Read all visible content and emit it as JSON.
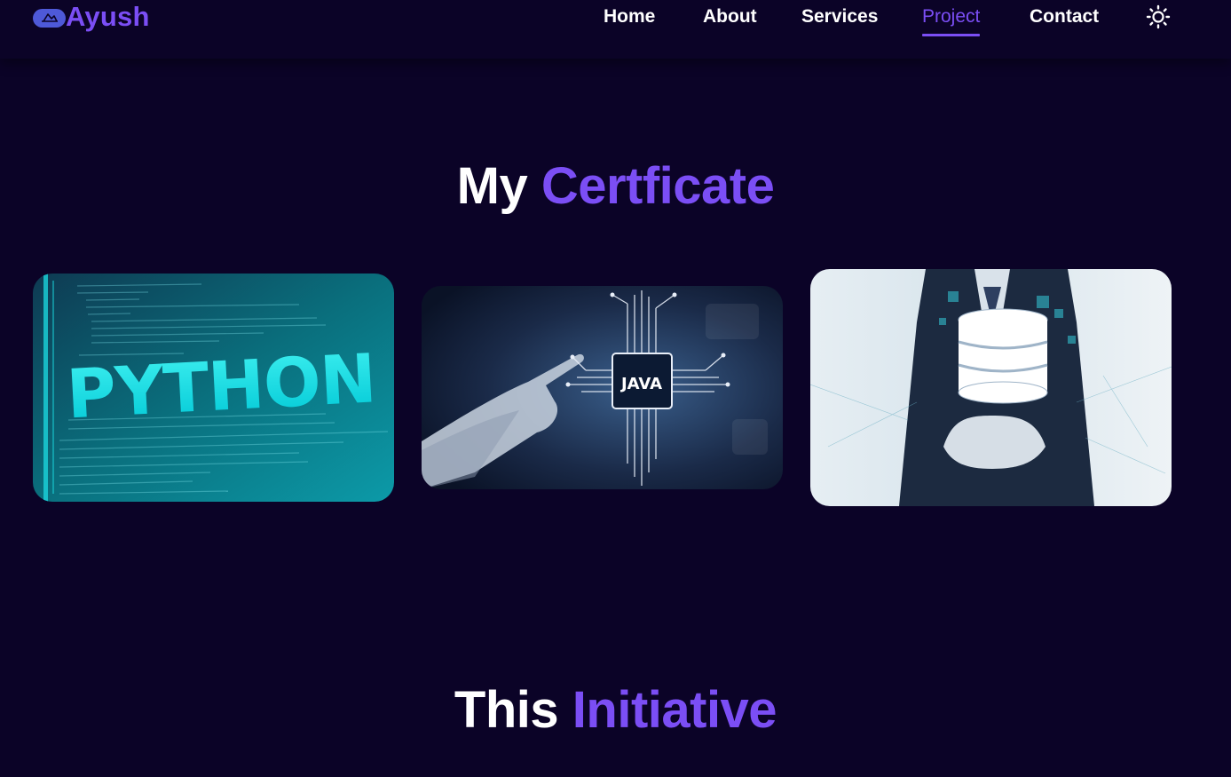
{
  "nav": {
    "brand": "Ayush",
    "links": [
      {
        "label": "Home"
      },
      {
        "label": "About"
      },
      {
        "label": "Services"
      },
      {
        "label": "Project",
        "active": true
      },
      {
        "label": "Contact"
      }
    ],
    "theme_icon": "sun-icon"
  },
  "certificates": {
    "title_prefix": "My",
    "title_accent": "Certficate",
    "cards": [
      {
        "image": "python-certificate-image",
        "text": "PYTHON"
      },
      {
        "image": "java-certificate-image",
        "text": "JAVA"
      },
      {
        "image": "database-certificate-image"
      }
    ]
  },
  "initiative": {
    "title_prefix": "This",
    "title_accent": "Initiative"
  },
  "colors": {
    "background": "#0b0327",
    "accent": "#7b4ef5",
    "logo": "#4e59d8",
    "text": "#ffffff"
  }
}
